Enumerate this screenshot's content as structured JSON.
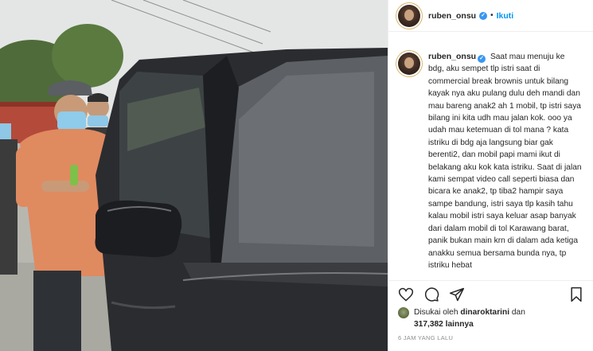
{
  "post": {
    "username": "ruben_onsu",
    "follow_label": "Ikuti",
    "separator": "•",
    "verified_mark": "✓",
    "caption": "Saat mau menuju ke bdg, aku sempet tlp istri saat di commercial break brownis untuk bilang kayak nya aku pulang dulu deh mandi dan mau bareng anak2 ah 1 mobil, tp istri saya bilang ini kita udh mau jalan kok. ooo ya udah mau ketemuan di tol mana ? kata istriku di bdg aja langsung biar gak berenti2, dan mobil papi mami ikut di belakang aku kok kata istriku. Saat di jalan kami sempat video call seperti biasa dan bicara ke anak2, tp tiba2 hampir saya sampe bandung, istri saya tlp kasih tahu kalau mobil istri saya keluar asap banyak dari dalam mobil di tol Karawang barat, panik bukan main krn di dalam ada ketiga anakku semua bersama bunda nya, tp istriku hebat",
    "likes_prefix": "Disukai oleh",
    "liked_by": "dinaroktarini",
    "likes_conjunction": "dan",
    "likes_count": "317,382",
    "likes_suffix": "lainnya",
    "timestamp": "6 JAM YANG LALU"
  },
  "icons": {
    "like": "heart-icon",
    "comment": "comment-icon",
    "share": "send-icon",
    "save": "bookmark-icon"
  },
  "colors": {
    "follow": "#0095f6",
    "verified": "#3897f0",
    "timestamp": "#8e8e8e"
  }
}
